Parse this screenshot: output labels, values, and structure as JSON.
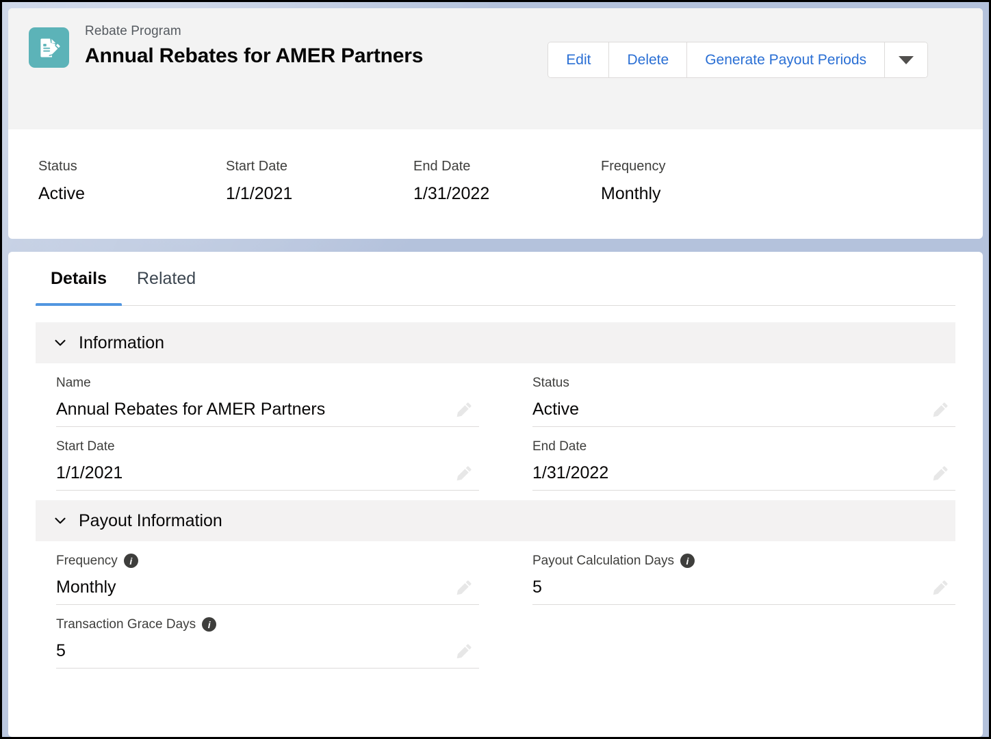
{
  "header": {
    "eyebrow": "Rebate Program",
    "title": "Annual Rebates for AMER Partners",
    "icon": "document-edit-icon",
    "icon_color": "#5cb3b8",
    "actions": [
      {
        "label": "Edit",
        "name": "edit-button"
      },
      {
        "label": "Delete",
        "name": "delete-button"
      },
      {
        "label": "Generate Payout Periods",
        "name": "generate-payout-periods-button"
      }
    ],
    "more_actions_icon": "chevron-down-icon"
  },
  "highlights": [
    {
      "label": "Status",
      "value": "Active"
    },
    {
      "label": "Start Date",
      "value": "1/1/2021"
    },
    {
      "label": "End Date",
      "value": "1/31/2022"
    },
    {
      "label": "Frequency",
      "value": "Monthly"
    }
  ],
  "tabs": [
    {
      "label": "Details",
      "active": true
    },
    {
      "label": "Related",
      "active": false
    }
  ],
  "accent_color": "#5196e0",
  "link_color": "#2a6fd4",
  "sections": [
    {
      "title": "Information",
      "collapse_icon": "chevron-down-icon",
      "fields": [
        {
          "label": "Name",
          "value": "Annual Rebates for AMER Partners",
          "info": false,
          "edit_icon": "pencil-icon"
        },
        {
          "label": "Status",
          "value": "Active",
          "info": false,
          "edit_icon": "pencil-icon"
        },
        {
          "label": "Start Date",
          "value": "1/1/2021",
          "info": false,
          "edit_icon": "pencil-icon"
        },
        {
          "label": "End Date",
          "value": "1/31/2022",
          "info": false,
          "edit_icon": "pencil-icon"
        }
      ]
    },
    {
      "title": "Payout Information",
      "collapse_icon": "chevron-down-icon",
      "fields": [
        {
          "label": "Frequency",
          "value": "Monthly",
          "info": true,
          "info_glyph": "i",
          "edit_icon": "pencil-icon"
        },
        {
          "label": "Payout Calculation Days",
          "value": "5",
          "info": true,
          "info_glyph": "i",
          "edit_icon": "pencil-icon"
        },
        {
          "label": "Transaction Grace Days",
          "value": "5",
          "info": true,
          "info_glyph": "i",
          "edit_icon": "pencil-icon"
        }
      ]
    }
  ]
}
